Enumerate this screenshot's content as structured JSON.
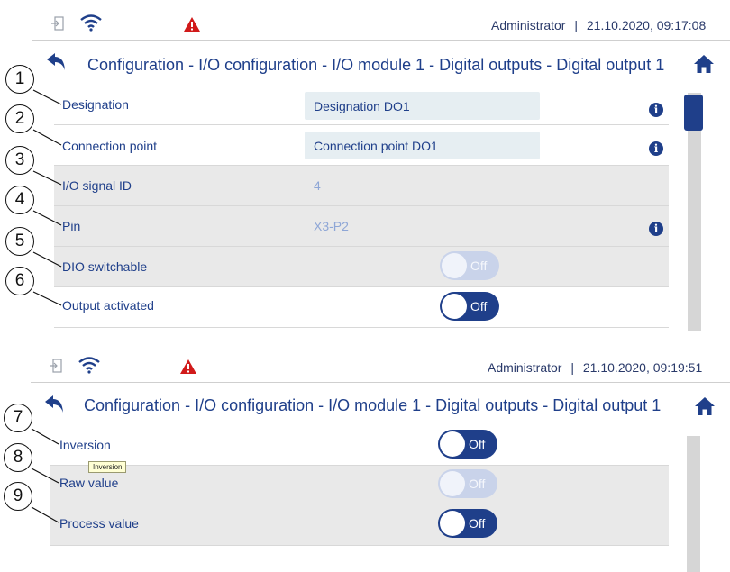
{
  "colors": {
    "accent": "#1f3f8a",
    "warning": "#d11a1a",
    "toggle_disabled": "#c9d3ea",
    "row_grey": "#e9e9e9",
    "field_bg": "#e6eef2"
  },
  "screen1": {
    "status": {
      "user": "Administrator",
      "separator": "|",
      "datetime": "21.10.2020, 09:17:08"
    },
    "title": "Configuration - I/O configuration - I/O module 1 - Digital outputs - Digital output 1",
    "rows": [
      {
        "label": "Designation",
        "value": "Designation DO1"
      },
      {
        "label": "Connection point",
        "value": "Connection point DO1"
      },
      {
        "label": "I/O signal ID",
        "value": "4"
      },
      {
        "label": "Pin",
        "value": "X3-P2"
      },
      {
        "label": "DIO switchable",
        "toggle": "Off"
      },
      {
        "label": "Output activated",
        "toggle": "Off"
      }
    ],
    "callouts": [
      "1",
      "2",
      "3",
      "4",
      "5",
      "6"
    ]
  },
  "screen2": {
    "status": {
      "user": "Administrator",
      "separator": "|",
      "datetime": "21.10.2020, 09:19:51"
    },
    "title": "Configuration - I/O configuration - I/O module 1 - Digital outputs - Digital output 1",
    "rows": [
      {
        "label": "Inversion",
        "toggle": "Off"
      },
      {
        "label": "Raw value",
        "toggle": "Off"
      },
      {
        "label": "Process value",
        "toggle": "Off"
      }
    ],
    "tooltip": "Inversion",
    "callouts": [
      "7",
      "8",
      "9"
    ]
  },
  "icons": [
    "login-icon",
    "wifi-icon",
    "warning-icon",
    "back-icon",
    "home-icon",
    "info-icon"
  ]
}
